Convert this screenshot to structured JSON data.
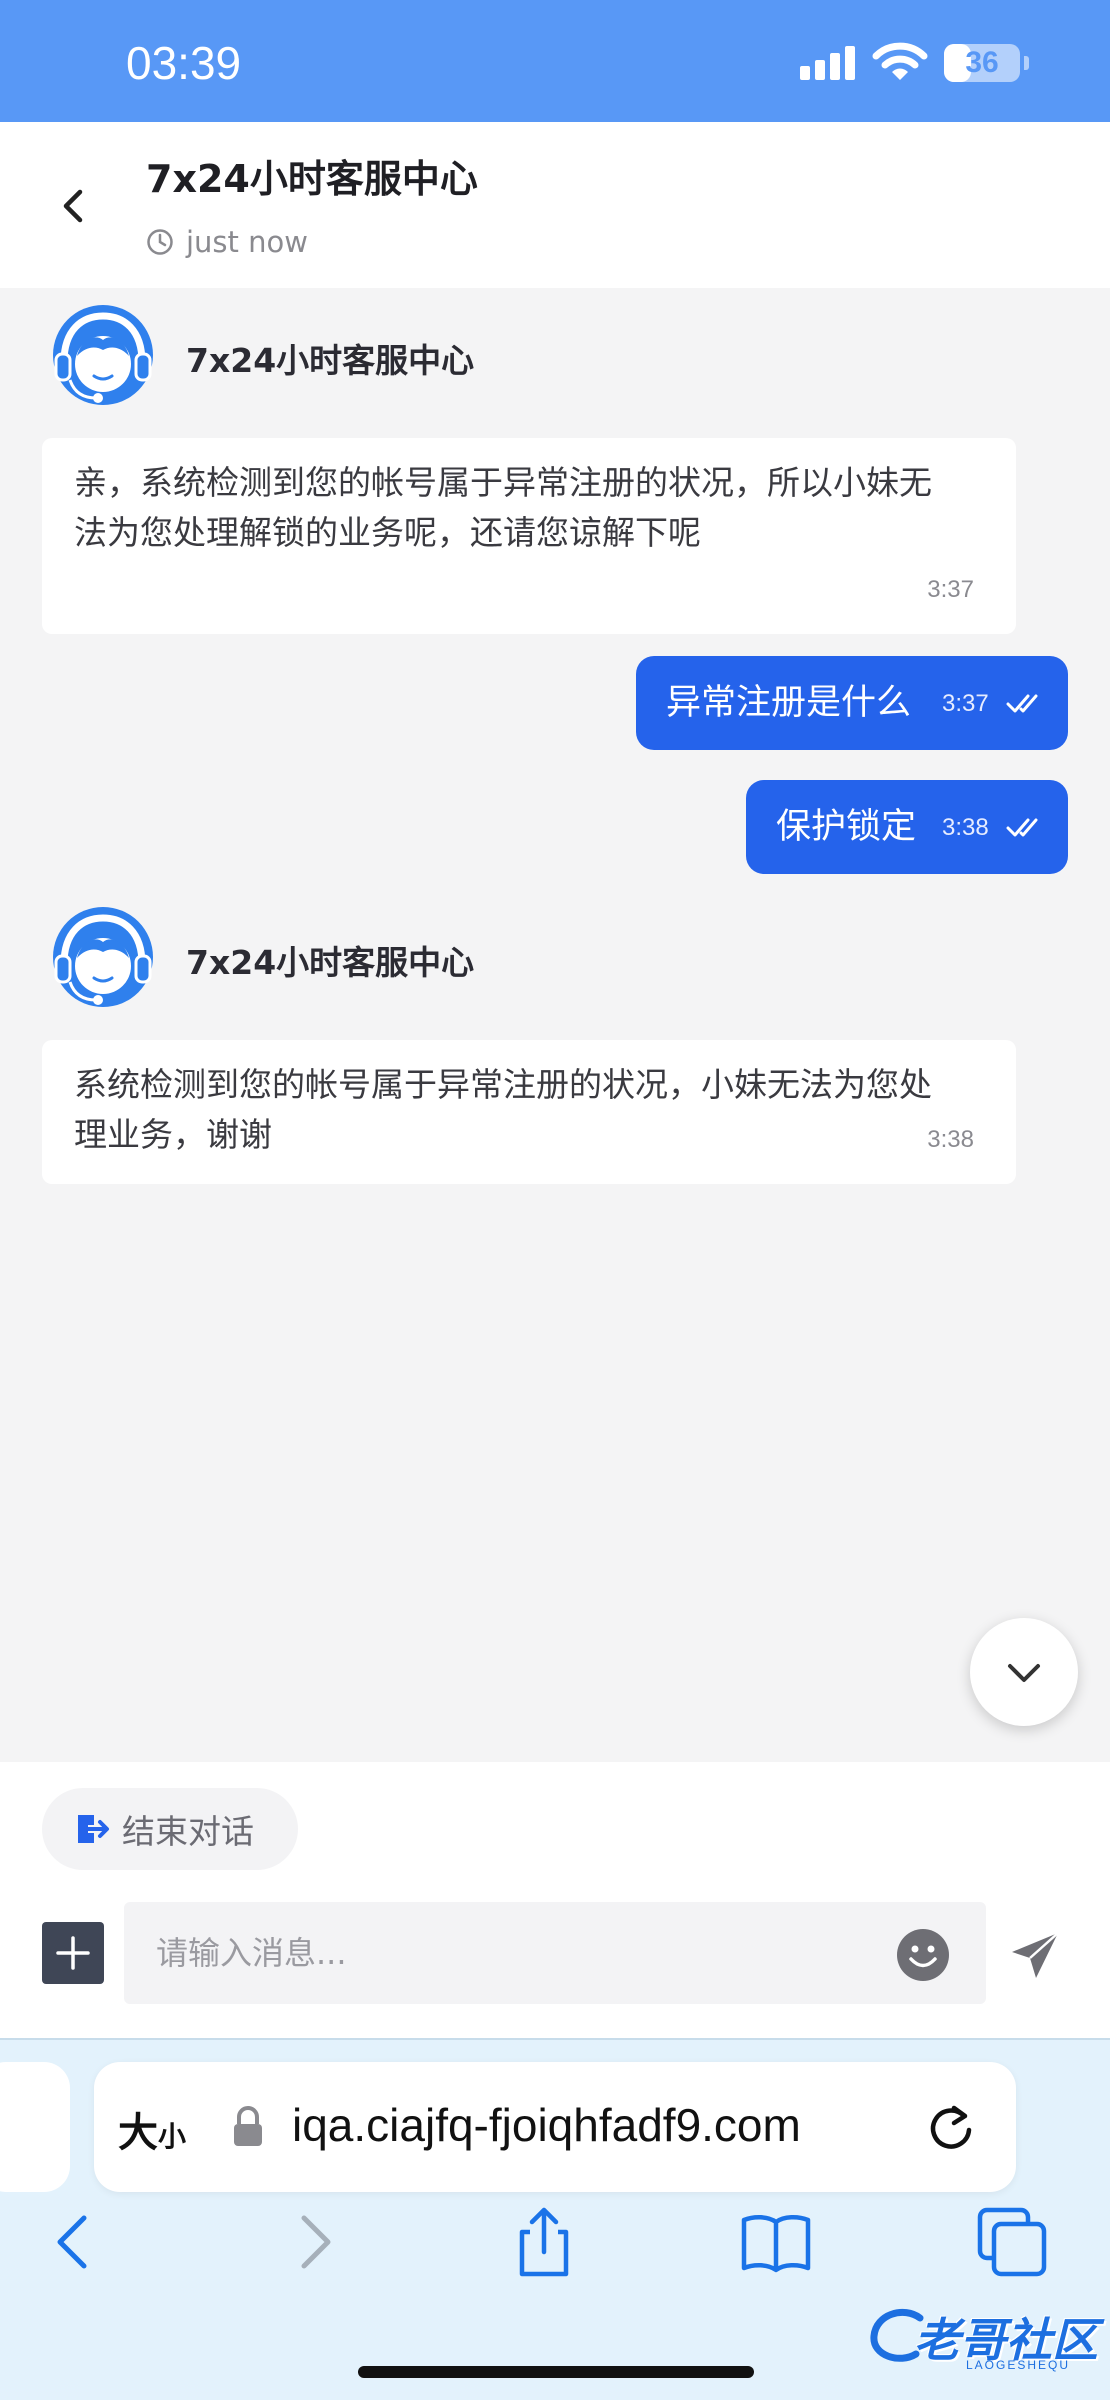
{
  "status_bar": {
    "time": "03:39",
    "battery": "36",
    "battery_level": 0.36
  },
  "header": {
    "title": "7x24小时客服中心",
    "subtitle": "just now"
  },
  "messages": [
    {
      "sender": "7x24小时客服中心",
      "text": "亲，系统检测到您的帐号属于异常注册的状况，所以小妹无法为您处理解锁的业务呢，还请您谅解下呢",
      "time": "3:37"
    },
    {
      "text": "异常注册是什么",
      "time": "3:37"
    },
    {
      "text": "保护锁定",
      "time": "3:38"
    },
    {
      "sender": "7x24小时客服中心",
      "text": "系统检测到您的帐号属于异常注册的状况，小妹无法为您处理业务，谢谢",
      "time": "3:38"
    }
  ],
  "input": {
    "end_chat_label": "结束对话",
    "placeholder": "请输入消息..."
  },
  "browser": {
    "text_size_label": "大",
    "text_size_small": "小",
    "url": "iqa.ciajfq-fjoiqhfadf9.com"
  },
  "watermark": {
    "text": "老哥社区",
    "sub": "LAOGESHEQU"
  },
  "colors": {
    "status_bar": "#5898f6",
    "accent": "#2563eb",
    "avatar": "#2f80ed",
    "background": "#f4f4f5"
  },
  "icons": [
    "back-icon",
    "clock-icon",
    "double-check-icon",
    "chevron-down-icon",
    "exit-icon",
    "plus-icon",
    "emoji-icon",
    "send-icon",
    "lock-icon",
    "reload-icon",
    "share-icon",
    "bookmarks-icon",
    "tabs-icon"
  ]
}
